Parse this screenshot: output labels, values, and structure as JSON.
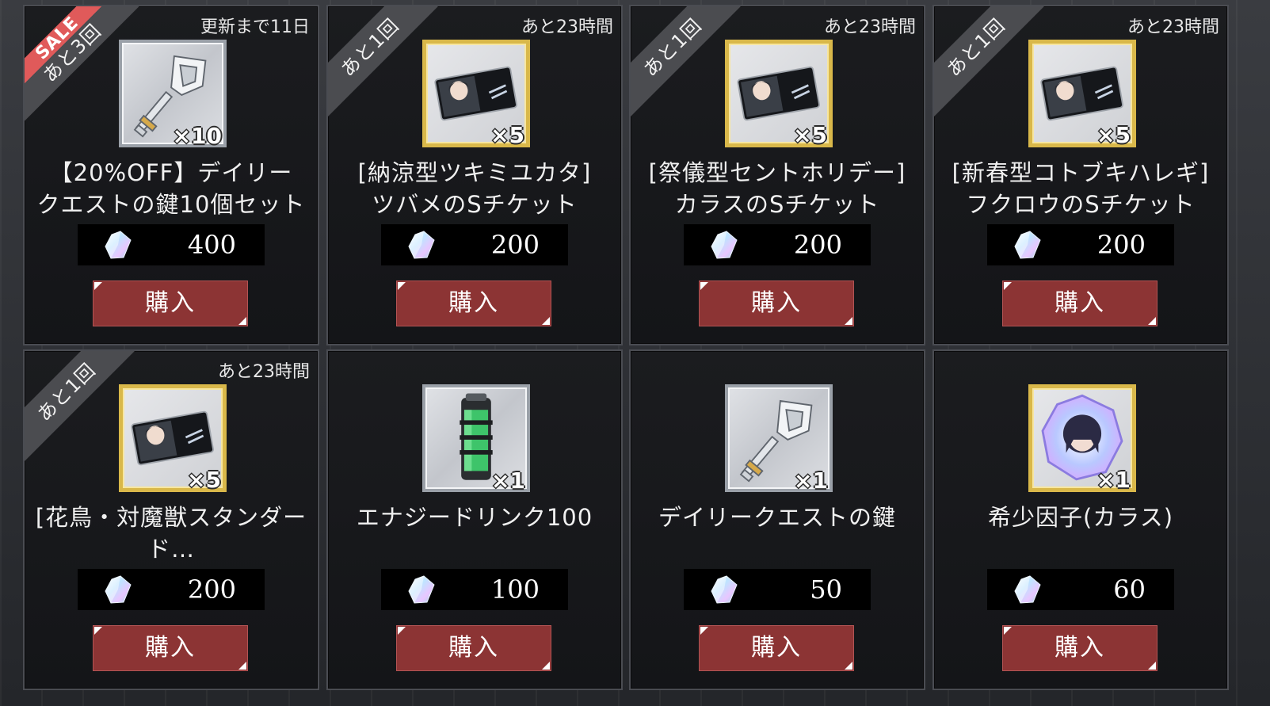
{
  "shop": {
    "items": [
      {
        "ribbon": "あと3回",
        "sale": "SALE",
        "timer": "更新まで11日",
        "qty": "×10",
        "name_line1": "【20%OFF】デイリー",
        "name_line2": "クエストの鍵10個セット",
        "price": "400",
        "buy_label": "購入",
        "icon": "silver-key-icon",
        "frame": "silver"
      },
      {
        "ribbon": "あと1回",
        "timer": "あと23時間",
        "qty": "×5",
        "name_line1": "[納涼型ツキミユカタ]",
        "name_line2": "ツバメのSチケット",
        "price": "200",
        "buy_label": "購入",
        "icon": "character-ticket-icon",
        "frame": "gold"
      },
      {
        "ribbon": "あと1回",
        "timer": "あと23時間",
        "qty": "×5",
        "name_line1": "[祭儀型セントホリデー]",
        "name_line2": "カラスのSチケット",
        "price": "200",
        "buy_label": "購入",
        "icon": "character-ticket-icon",
        "frame": "gold"
      },
      {
        "ribbon": "あと1回",
        "timer": "あと23時間",
        "qty": "×5",
        "name_line1": "[新春型コトブキハレギ]",
        "name_line2": "フクロウのSチケット",
        "price": "200",
        "buy_label": "購入",
        "icon": "character-ticket-icon",
        "frame": "gold"
      },
      {
        "ribbon": "あと1回",
        "timer": "あと23時間",
        "qty": "×5",
        "name_line1": "[花鳥・対魔獣スタンダー",
        "name_line2": "ド…",
        "price": "200",
        "buy_label": "購入",
        "icon": "character-ticket-icon",
        "frame": "gold"
      },
      {
        "ribbon": "",
        "timer": "",
        "qty": "×1",
        "name_line1": "エナジードリンク100",
        "name_line2": "",
        "price": "100",
        "buy_label": "購入",
        "icon": "energy-drink-icon",
        "frame": "silver"
      },
      {
        "ribbon": "",
        "timer": "",
        "qty": "×1",
        "name_line1": "デイリークエストの鍵",
        "name_line2": "",
        "price": "50",
        "buy_label": "購入",
        "icon": "silver-key-icon",
        "frame": "silver"
      },
      {
        "ribbon": "",
        "timer": "",
        "qty": "×1",
        "name_line1": "希少因子(カラス)",
        "name_line2": "",
        "price": "60",
        "buy_label": "購入",
        "icon": "rare-factor-crystal-icon",
        "frame": "gold"
      }
    ]
  },
  "colors": {
    "buy_button": "#8c3434",
    "gold_frame": "#d9b84a",
    "silver_frame": "#9aa0a8",
    "sale_ribbon": "#e05a5a"
  }
}
